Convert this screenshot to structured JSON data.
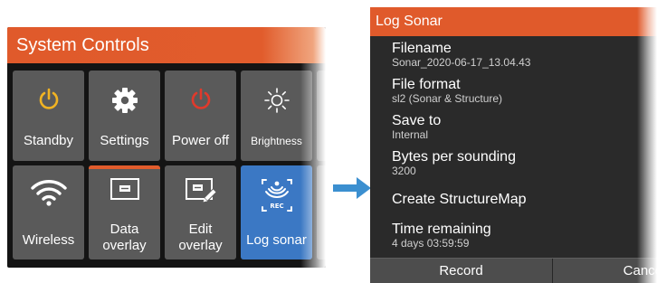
{
  "system_controls": {
    "title": "System Controls",
    "tiles": [
      {
        "label": "Standby",
        "icon": "power-icon",
        "icon_color": "#f0b323"
      },
      {
        "label": "Settings",
        "icon": "gear-icon",
        "icon_color": "#ffffff"
      },
      {
        "label": "Power off",
        "icon": "power-icon",
        "icon_color": "#e03a2c"
      },
      {
        "label": "Brightness",
        "icon": "sun-icon",
        "icon_color": "#ffffff"
      },
      {
        "label": "Wireless",
        "icon": "wifi-icon",
        "icon_color": "#ffffff"
      },
      {
        "label_line1": "Data",
        "label_line2": "overlay",
        "icon": "data-overlay-icon",
        "icon_color": "#ffffff"
      },
      {
        "label_line1": "Edit",
        "label_line2": "overlay",
        "icon": "edit-overlay-icon",
        "icon_color": "#ffffff"
      },
      {
        "label": "Log sonar",
        "icon": "sonar-rec-icon",
        "icon_color": "#ffffff",
        "icon_text": "REC",
        "active": true
      }
    ]
  },
  "arrow_color": "#3b8fd0",
  "log_sonar": {
    "title": "Log Sonar",
    "rows": [
      {
        "label": "Filename",
        "value": "Sonar_2020-06-17_13.04.43"
      },
      {
        "label": "File format",
        "value": "sl2 (Sonar & Structure)"
      },
      {
        "label": "Save to",
        "value": "Internal"
      },
      {
        "label": "Bytes per sounding",
        "value": "3200"
      },
      {
        "label": "Create StructureMap"
      },
      {
        "label": "Time remaining",
        "value": "4 days 03:59:59"
      }
    ],
    "buttons": {
      "record": "Record",
      "cancel": "Cancel"
    }
  },
  "colors": {
    "accent_orange": "#e05a2b",
    "tile_gray": "#5a5a5a",
    "active_blue": "#3b78c4",
    "dialog_bg": "#2a2a2a"
  }
}
